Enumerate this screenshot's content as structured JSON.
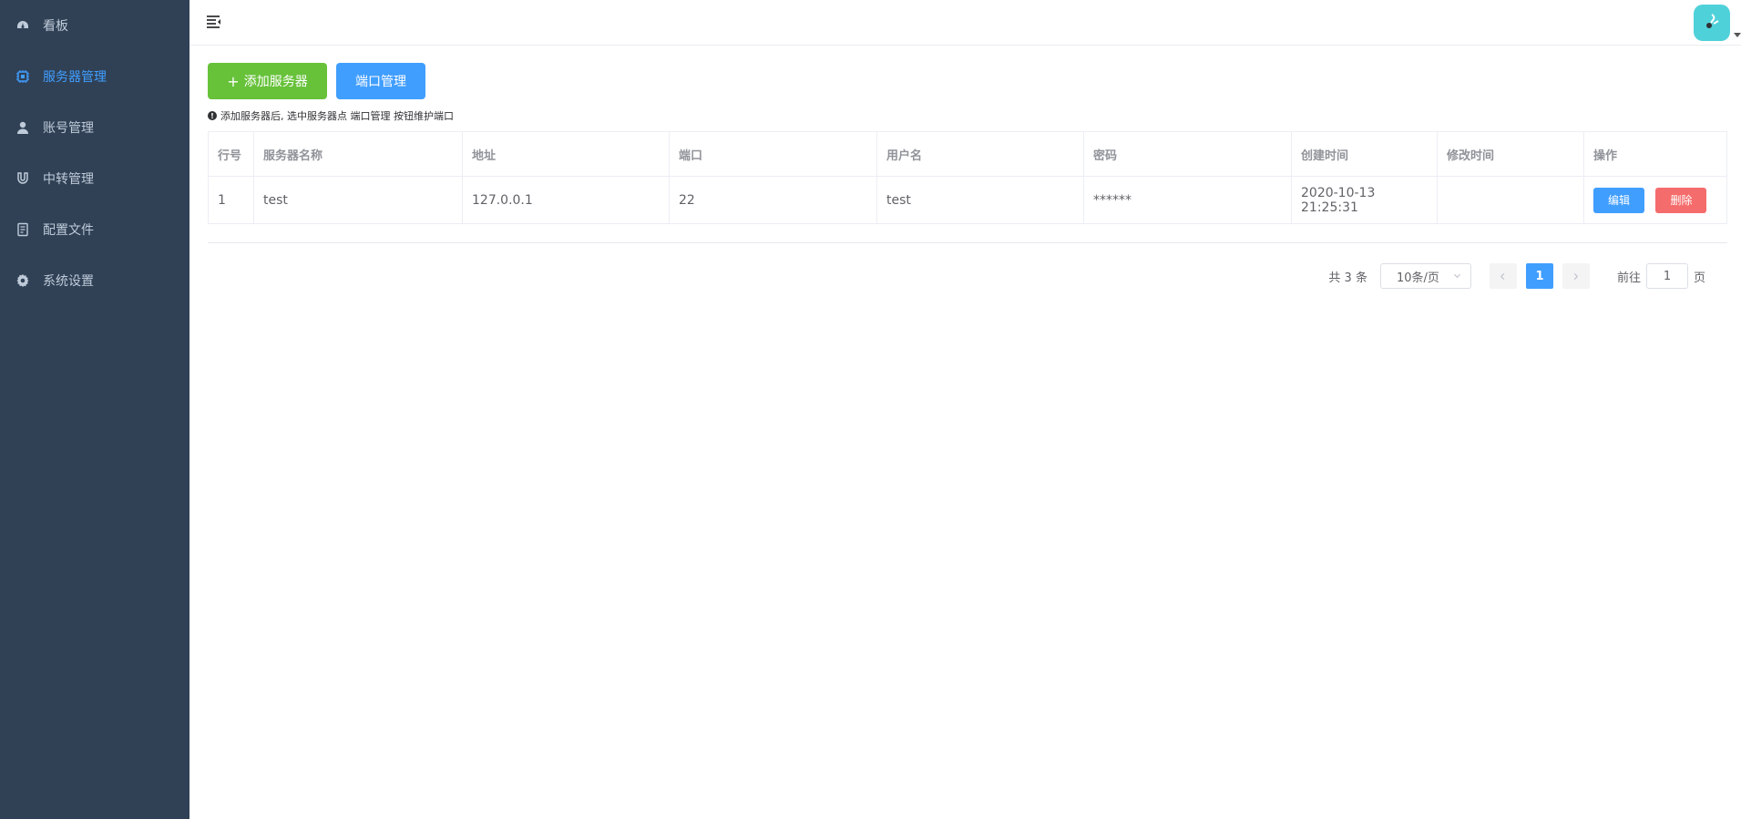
{
  "sidebar": {
    "items": [
      {
        "label": "看板",
        "icon": "dashboard-icon",
        "active": false
      },
      {
        "label": "服务器管理",
        "icon": "cpu-icon",
        "active": true
      },
      {
        "label": "账号管理",
        "icon": "user-icon",
        "active": false
      },
      {
        "label": "中转管理",
        "icon": "magnet-icon",
        "active": false
      },
      {
        "label": "配置文件",
        "icon": "document-icon",
        "active": false
      },
      {
        "label": "系统设置",
        "icon": "gear-icon",
        "active": false
      }
    ]
  },
  "toolbar": {
    "add_server_label": "添加服务器",
    "port_manage_label": "端口管理",
    "tip": "添加服务器后, 选中服务器点 端口管理 按钮维护端口"
  },
  "table": {
    "headers": [
      "行号",
      "服务器名称",
      "地址",
      "端口",
      "用户名",
      "密码",
      "创建时间",
      "修改时间",
      "操作"
    ],
    "rows": [
      {
        "index": "1",
        "name": "test",
        "address": "127.0.0.1",
        "port": "22",
        "username": "test",
        "password": "******",
        "created": "2020-10-13 21:25:31",
        "modified": "",
        "edit_label": "编辑",
        "delete_label": "删除"
      }
    ]
  },
  "pagination": {
    "total": "共 3 条",
    "page_size": "10条/页",
    "current_page": "1",
    "goto_label": "前往",
    "goto_value": "1",
    "page_suffix": "页"
  },
  "colors": {
    "sidebar_bg": "#304156",
    "accent": "#409EFF",
    "success": "#67c23a",
    "danger": "#f56c6c"
  }
}
